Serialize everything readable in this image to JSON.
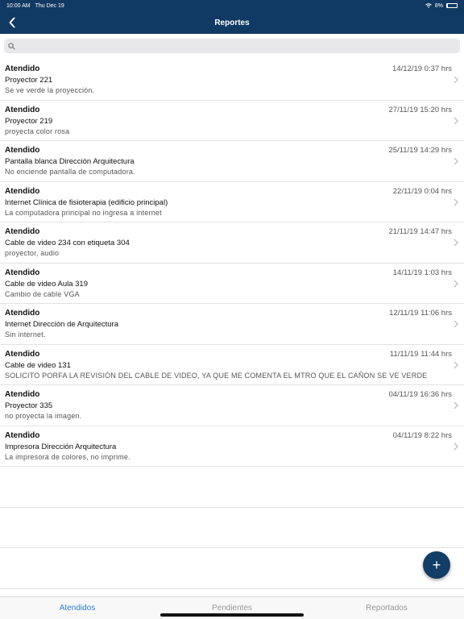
{
  "statusbar": {
    "time": "10:00 AM",
    "date": "Thu Dec 19",
    "battery": "8%",
    "battery_level": 0.08
  },
  "navbar": {
    "title": "Reportes",
    "back_icon": "chevron-left-icon"
  },
  "search": {
    "placeholder": "",
    "value": "",
    "icon": "search-icon"
  },
  "reports": [
    {
      "status": "Atendido",
      "name": "Proyector 221",
      "description": "Se ve verde la proyección.",
      "date": "14/12/19 0:37 hrs"
    },
    {
      "status": "Atendido",
      "name": "Proyector 219",
      "description": "proyecta color rosa",
      "date": "27/11/19 15:20 hrs"
    },
    {
      "status": "Atendido",
      "name": "Pantalla blanca Dirección Arquitectura",
      "description": "No enciende pantalla de computadora.",
      "date": "25/11/19 14:29 hrs"
    },
    {
      "status": "Atendido",
      "name": "Internet Clínica de fisioterapia (edificio principal)",
      "description": "La computadora principal  no ingresa a internet",
      "date": "22/11/19 0:04 hrs"
    },
    {
      "status": "Atendido",
      "name": "Cable de video 234 con etiqueta 304",
      "description": "proyector, audio",
      "date": "21/11/19 14:47 hrs"
    },
    {
      "status": "Atendido",
      "name": "Cable de video  Aula 319",
      "description": "Cambio de cable VGA",
      "date": "14/11/19 1:03 hrs"
    },
    {
      "status": "Atendido",
      "name": "Internet Dirección de Arquitectura",
      "description": "Sin internet.",
      "date": "12/11/19 11:06 hrs"
    },
    {
      "status": "Atendido",
      "name": "Cable de video 131",
      "description": "SOLICITO PORFA LA REVISIÓN DEL CABLE DE VIDEO, YA QUE ME COMENTA EL MTRO QUE EL CAÑON SE VE VERDE",
      "date": "11/11/19 11:44 hrs"
    },
    {
      "status": "Atendido",
      "name": "Proyector 335",
      "description": "no proyecta la imagen.",
      "date": "04/11/19 16:36 hrs"
    },
    {
      "status": "Atendido",
      "name": "Impresora Dirección Arquitectura",
      "description": "La impresora de colores, no imprime.",
      "date": "04/11/19 8:22 hrs"
    }
  ],
  "fab": {
    "label": "+"
  },
  "tabs": [
    {
      "label": "Atendidos",
      "active": true
    },
    {
      "label": "Pendientes",
      "active": false
    },
    {
      "label": "Reportados",
      "active": false
    }
  ],
  "colors": {
    "header": "#103a63",
    "active_tab": "#2b7fd6",
    "fab": "#123d66"
  }
}
